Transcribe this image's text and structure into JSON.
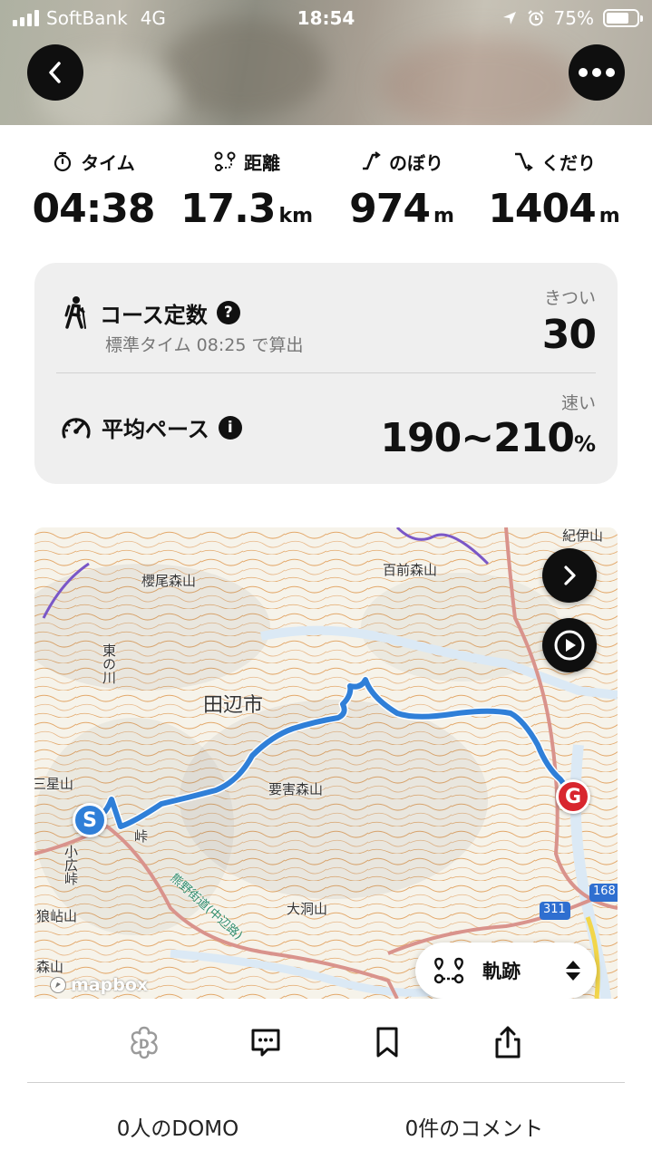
{
  "status_bar": {
    "carrier": "SoftBank",
    "network": "4G",
    "time": "18:54",
    "battery": "75%",
    "battery_level": 0.75
  },
  "header": {
    "back_icon": "chevron-left-icon",
    "more_icon": "more-dots-icon"
  },
  "stats": [
    {
      "label": "タイム",
      "value": "04:38",
      "unit": "",
      "icon": "stopwatch-icon"
    },
    {
      "label": "距離",
      "value": "17.3",
      "unit": "km",
      "icon": "route-icon"
    },
    {
      "label": "のぼり",
      "value": "974",
      "unit": "m",
      "icon": "ascent-icon"
    },
    {
      "label": "くだり",
      "value": "1404",
      "unit": "m",
      "icon": "descent-icon"
    }
  ],
  "course": {
    "title": "コース定数",
    "help": "?",
    "subtitle": "標準タイム 08:25 で算出",
    "rating_label": "きつい",
    "value": "30"
  },
  "pace": {
    "title": "平均ペース",
    "info": "i",
    "rating_label": "速い",
    "value": "190~210",
    "unit": "%"
  },
  "map": {
    "labels": {
      "city": "田辺市",
      "m1": "櫻尾森山",
      "m2": "百前森山",
      "m3": "要害森山",
      "m4": "大洞山",
      "m5": "小広峠",
      "m6": "狼岾山",
      "m7": "三星山",
      "m8": "森山",
      "m9": "紀伊山",
      "river": "東の川",
      "road": "熊野街道(中辺路)",
      "pass": "峠",
      "r311": "311",
      "r168": "168"
    },
    "start_label": "S",
    "goal_label": "G",
    "attribution": "mapbox",
    "track_label": "軌跡",
    "accent": "#2f7fd8",
    "goal_color": "#d8262e"
  },
  "bottom": {
    "domo_count": "0人のDOMO",
    "comment_count": "0件のコメント"
  }
}
